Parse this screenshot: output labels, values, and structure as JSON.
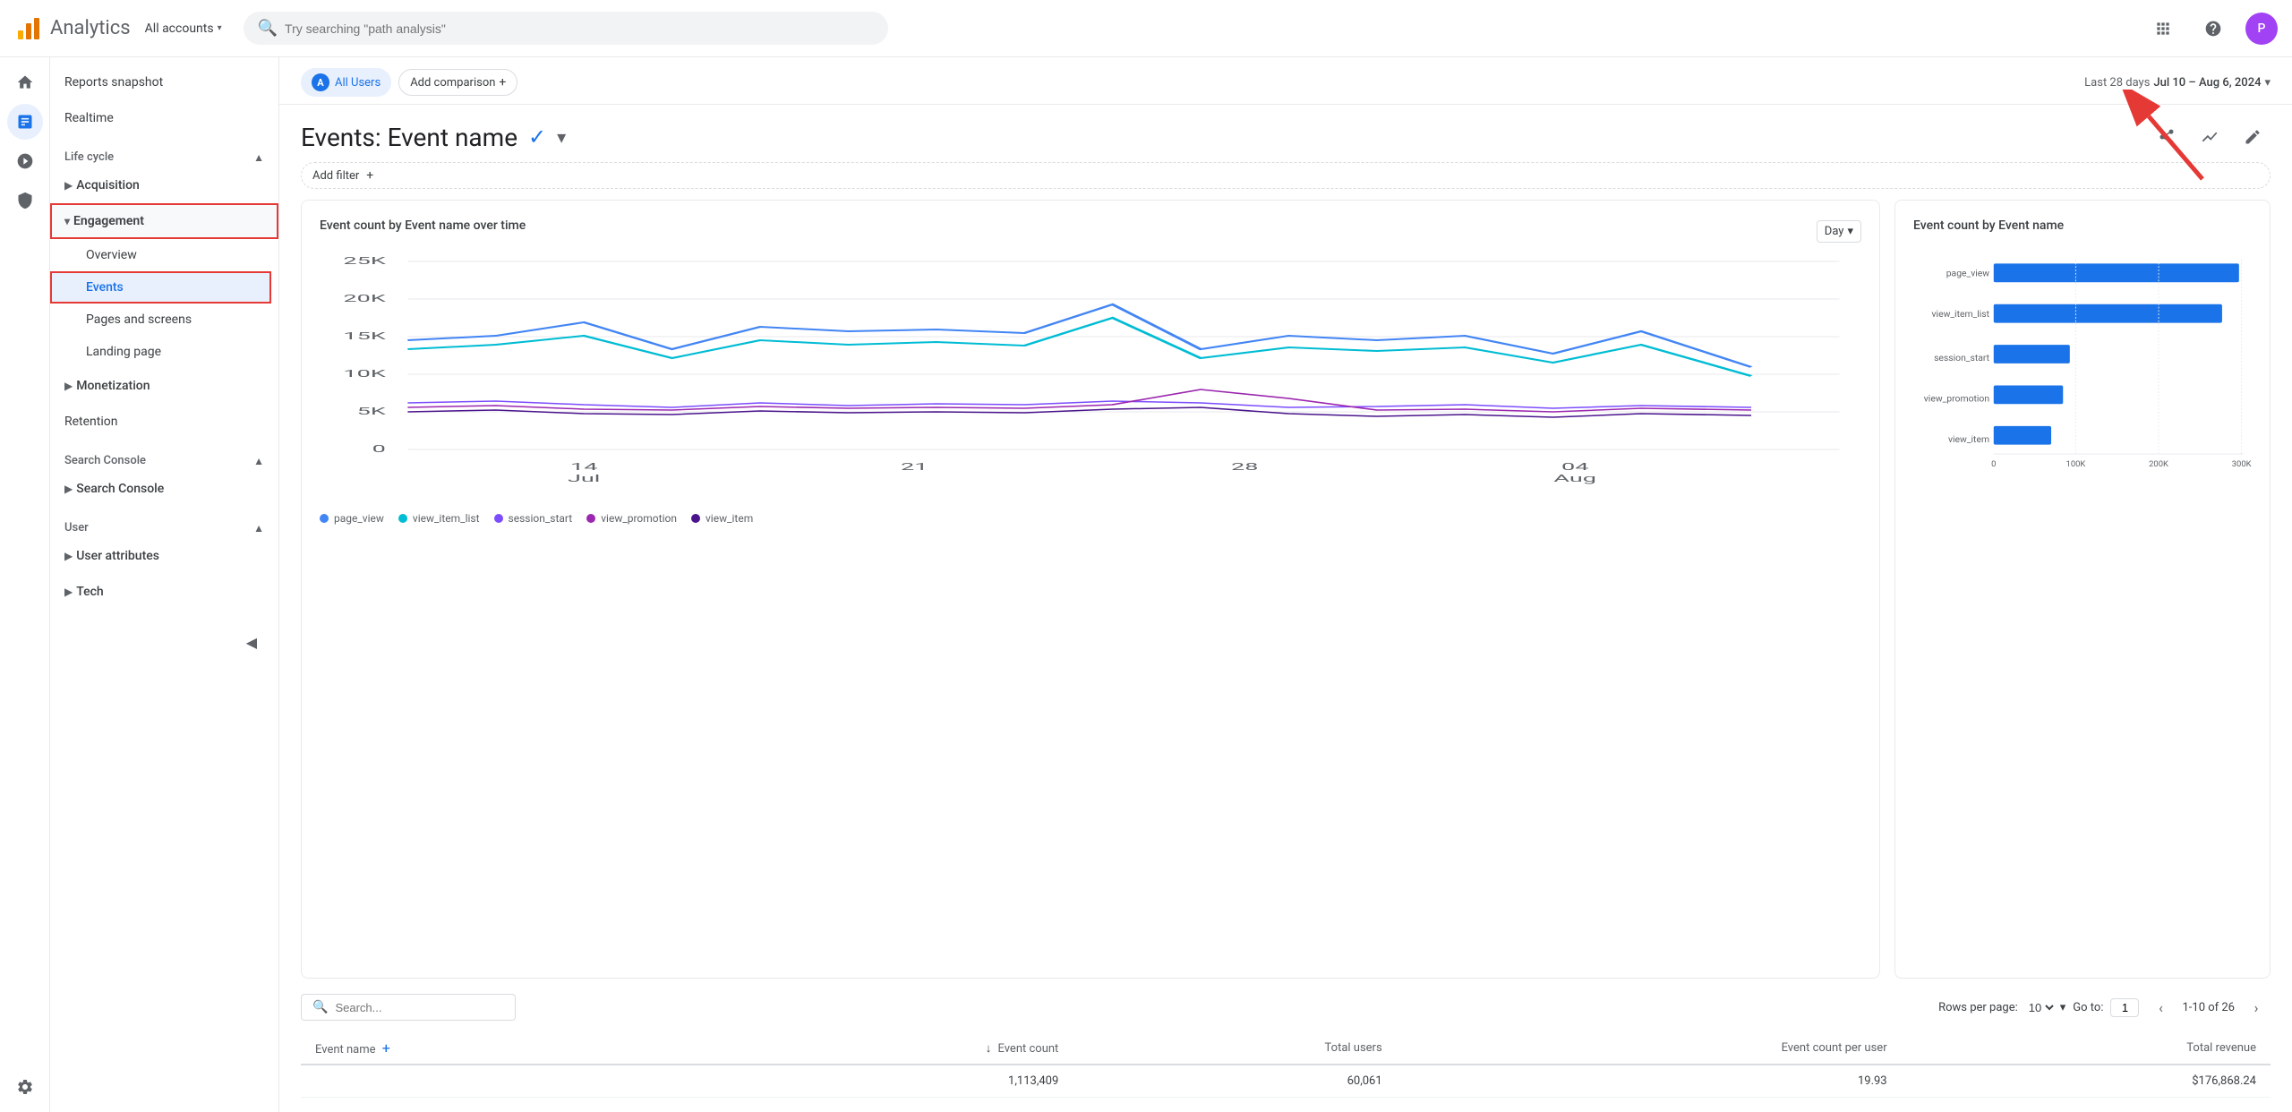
{
  "app": {
    "title": "Analytics",
    "account": "All accounts",
    "search_placeholder": "Try searching \"path analysis\""
  },
  "topbar": {
    "avatar_initials": "P"
  },
  "sidebar": {
    "reports_snapshot": "Reports snapshot",
    "realtime": "Realtime",
    "lifecycle_label": "Life cycle",
    "acquisition": "Acquisition",
    "engagement": "Engagement",
    "overview": "Overview",
    "events": "Events",
    "pages_screens": "Pages and screens",
    "landing_page": "Landing page",
    "monetization": "Monetization",
    "retention": "Retention",
    "search_console_section": "Search Console",
    "search_console_item": "Search Console",
    "user_section": "User",
    "user_attributes": "User attributes",
    "tech": "Tech"
  },
  "header": {
    "all_users_label": "All Users",
    "add_comparison_label": "Add comparison",
    "date_range_label": "Last 28 days",
    "date_range_value": "Jul 10 – Aug 6, 2024"
  },
  "page": {
    "title": "Events: Event name",
    "add_filter_label": "Add filter"
  },
  "line_chart": {
    "title": "Event count by Event name over time",
    "day_selector": "Day",
    "x_labels": [
      "14\nJul",
      "21",
      "28",
      "04\nAug"
    ],
    "y_labels": [
      "25K",
      "20K",
      "15K",
      "10K",
      "5K",
      "0"
    ],
    "legend": [
      {
        "label": "page_view",
        "color": "#4285f4"
      },
      {
        "label": "view_item_list",
        "color": "#00bcd4"
      },
      {
        "label": "session_start",
        "color": "#7c4dff"
      },
      {
        "label": "view_promotion",
        "color": "#9c27b0"
      },
      {
        "label": "view_item",
        "color": "#4a148c"
      }
    ]
  },
  "bar_chart": {
    "title": "Event count by Event name",
    "x_labels": [
      "0",
      "100K",
      "200K",
      "300K"
    ],
    "bars": [
      {
        "label": "page_view",
        "value": 300,
        "color": "#1a73e8"
      },
      {
        "label": "view_item_list",
        "value": 280,
        "color": "#1a73e8"
      },
      {
        "label": "session_start",
        "value": 90,
        "color": "#1a73e8"
      },
      {
        "label": "view_promotion",
        "value": 85,
        "color": "#1a73e8"
      },
      {
        "label": "view_item",
        "value": 70,
        "color": "#1a73e8"
      }
    ]
  },
  "table": {
    "search_placeholder": "Search...",
    "rows_per_page_label": "Rows per page:",
    "rows_per_page_value": "10",
    "go_to_label": "Go to:",
    "go_to_value": "1",
    "pagination_range": "1-10 of 26",
    "columns": [
      "Event name",
      "↓ Event count",
      "Total users",
      "Event count per user",
      "Total revenue"
    ],
    "totals": [
      "",
      "1,113,409",
      "60,061",
      "19.93",
      "$176,868.24"
    ]
  }
}
